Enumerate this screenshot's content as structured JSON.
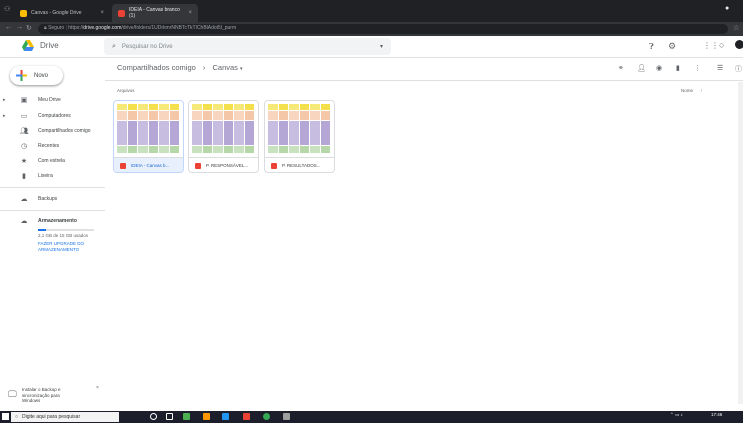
{
  "browser": {
    "tabs": [
      {
        "title": "Canvas - Google Drive",
        "active": false,
        "color": "#fbbc04"
      },
      {
        "title": "IDEIA - Canvas branco (1)",
        "active": true,
        "color": "#ea4335"
      }
    ],
    "security_label": "Seguro",
    "url_scheme": "https://",
    "url_domain": "drive.google.com",
    "url_path": "/drive/folders/1UDrkmrNNBTcTkTIChBlAdot5l_purm"
  },
  "drive": {
    "logo_text": "Drive",
    "search_placeholder": "Pesquisar no Drive",
    "breadcrumb": [
      "Compartilhados comigo",
      "Canvas"
    ],
    "sidebar": {
      "new_label": "Novo",
      "items": [
        {
          "label": "Meu Drive",
          "icon": "drive-icon",
          "expandable": true
        },
        {
          "label": "Computadores",
          "icon": "computer-icon",
          "expandable": true
        },
        {
          "label": "Compartilhados comigo",
          "icon": "people-icon",
          "expandable": false
        },
        {
          "label": "Recentes",
          "icon": "clock-icon",
          "expandable": false
        },
        {
          "label": "Com estrela",
          "icon": "star-icon",
          "expandable": false
        },
        {
          "label": "Lixeira",
          "icon": "trash-icon",
          "expandable": false
        },
        {
          "label": "Backups",
          "icon": "cloud-icon",
          "expandable": false
        }
      ],
      "storage": {
        "title": "Armazenamento",
        "usage": "2,1 GB de 15 GB usados",
        "used_fraction": 0.14,
        "upgrade": "FAZER UPGRADE DO ARMAZENAMENTO"
      }
    },
    "files_section_label": "Arquivos",
    "sort_label": "Nome",
    "files": [
      {
        "name": "IDEIA - Canvas b...",
        "selected": true
      },
      {
        "name": "P. RESPONSÁVEL...",
        "selected": false
      },
      {
        "name": "P. RESULTADOS...",
        "selected": false
      }
    ],
    "backup_prompt": "Instalar o Backup e sincronização para Windows"
  },
  "taskbar": {
    "search_placeholder": "Digite aqui para pesquisar",
    "time": "17:46"
  },
  "colors": {
    "accent": "#1a73e8",
    "selected_bg": "#e8f0fe",
    "pdf": "#ea4335",
    "thumb_yellow": "#f4e04d",
    "thumb_orange": "#f4c7a8",
    "thumb_purple": "#b4a7d6",
    "thumb_green": "#b6d7a8"
  }
}
